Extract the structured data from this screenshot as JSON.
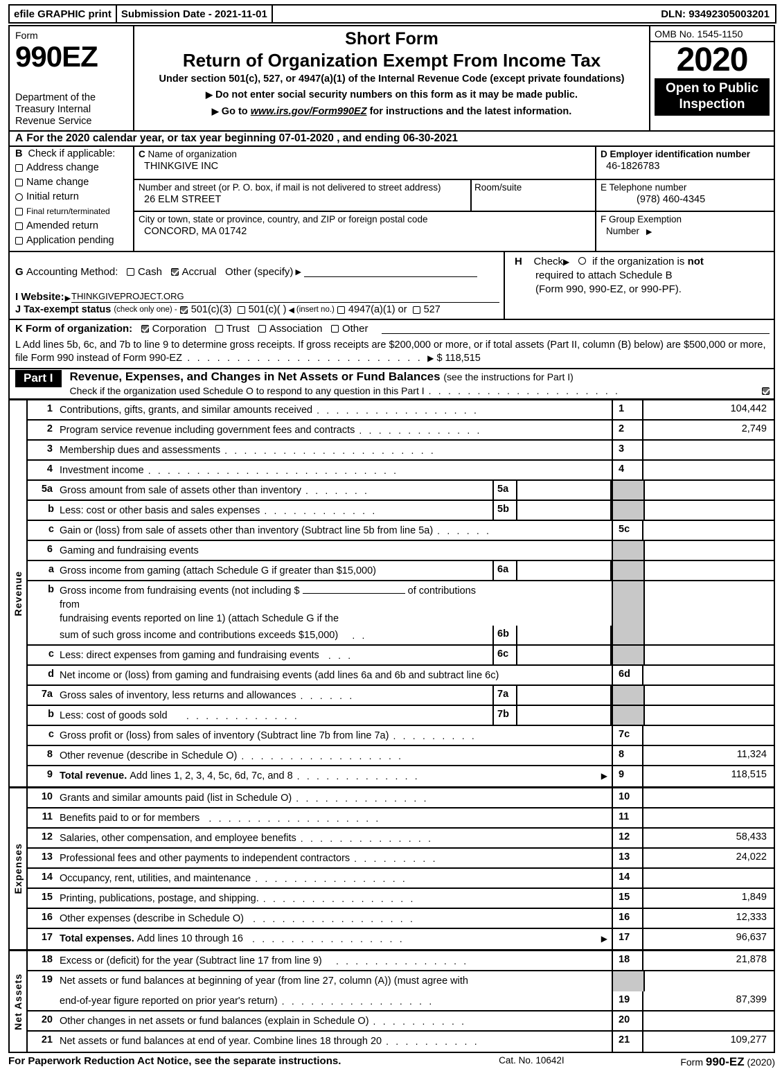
{
  "efile": {
    "print_label": "efile GRAPHIC print",
    "submission_date": "Submission Date - 2021-11-01",
    "dln": "DLN: 93492305003201"
  },
  "header": {
    "form_label": "Form",
    "form_number": "990EZ",
    "department": "Department of the Treasury Internal Revenue Service",
    "title_short": "Short Form",
    "title_main": "Return of Organization Exempt From Income Tax",
    "subtitle": "Under section 501(c), 527, or 4947(a)(1) of the Internal Revenue Code (except private foundations)",
    "bullet1": "Do not enter social security numbers on this form as it may be made public.",
    "bullet2_pre": "Go to",
    "bullet2_link": "www.irs.gov/Form990EZ",
    "bullet2_post": "for instructions and the latest information.",
    "omb": "OMB No. 1545-1150",
    "tax_year": "2020",
    "open_to_public": "Open to Public Inspection"
  },
  "line_a": {
    "letter": "A",
    "text": "For the 2020 calendar year, or tax year beginning 07-01-2020 , and ending 06-30-2021"
  },
  "section_b": {
    "letter": "B",
    "heading": "Check if applicable:",
    "items": [
      {
        "label": "Address change",
        "checked": false,
        "shape": "square"
      },
      {
        "label": "Name change",
        "checked": false,
        "shape": "square"
      },
      {
        "label": "Initial return",
        "checked": false,
        "shape": "round"
      },
      {
        "label": "Final return/terminated",
        "checked": false,
        "shape": "square",
        "small": true
      },
      {
        "label": "Amended return",
        "checked": false,
        "shape": "square"
      },
      {
        "label": "Application pending",
        "checked": false,
        "shape": "square"
      }
    ]
  },
  "section_c": {
    "letter": "C",
    "name_label": "Name of organization",
    "name_value": "THINKGIVE INC",
    "street_label": "Number and street (or P. O. box, if mail is not delivered to street address)",
    "street_value": "26 ELM STREET",
    "room_label": "Room/suite",
    "room_value": "",
    "city_label": "City or town, state or province, country, and ZIP or foreign postal code",
    "city_value": "CONCORD, MA   01742"
  },
  "section_d": {
    "ein_label": "D Employer identification number",
    "ein_value": "46-1826783",
    "tel_label": "E Telephone number",
    "tel_value": "(978) 460-4345",
    "group_label": "F Group Exemption",
    "group_label2": "Number",
    "group_value": ""
  },
  "section_g": {
    "letter": "G",
    "label": "Accounting Method:",
    "cash": "Cash",
    "cash_checked": false,
    "accrual": "Accrual",
    "accrual_checked": true,
    "other": "Other (specify)",
    "other_value": ""
  },
  "section_h": {
    "letter": "H",
    "text_pre": "Check",
    "text_post": "if the organization is",
    "not_word": "not",
    "line2": "required to attach Schedule B",
    "line3": "(Form 990, 990-EZ, or 990-PF).",
    "checked": false
  },
  "section_i": {
    "label": "I Website:",
    "value": "THINKGIVEPROJECT.ORG"
  },
  "section_j": {
    "label": "J Tax-exempt status",
    "note": "(check only one) -",
    "opt1": "501(c)(3)",
    "opt1_checked": true,
    "opt2": "501(c)(    )",
    "opt2_checked": false,
    "insert": "(insert no.)",
    "opt3": "4947(a)(1) or",
    "opt3_checked": false,
    "opt4": "527",
    "opt4_checked": false
  },
  "section_k": {
    "label": "K Form of organization:",
    "options": [
      {
        "label": "Corporation",
        "checked": true
      },
      {
        "label": "Trust",
        "checked": false
      },
      {
        "label": "Association",
        "checked": false
      },
      {
        "label": "Other",
        "checked": false
      }
    ]
  },
  "section_l": {
    "text": "L Add lines 5b, 6c, and 7b to line 9 to determine gross receipts. If gross receipts are $200,000 or more, or if total assets (Part II, column (B) below) are $500,000 or more, file Form 990 instead of Form 990-EZ",
    "amount": "$ 118,515"
  },
  "part1": {
    "tag": "Part I",
    "title": "Revenue, Expenses, and Changes in Net Assets or Fund Balances",
    "title_note": "(see the instructions for Part I)",
    "check_text": "Check if the organization used Schedule O to respond to any question in this Part I",
    "checked": true
  },
  "side_labels": {
    "revenue": "Revenue",
    "expenses": "Expenses",
    "net_assets": "Net Assets"
  },
  "revenue_lines": [
    {
      "no": "1",
      "text": "Contributions, gifts, grants, and similar amounts received",
      "box": "1",
      "amount": "104,442",
      "dots": true
    },
    {
      "no": "2",
      "text": "Program service revenue including government fees and contracts",
      "box": "2",
      "amount": "2,749",
      "dots": true
    },
    {
      "no": "3",
      "text": "Membership dues and assessments",
      "box": "3",
      "amount": "",
      "dots": true
    },
    {
      "no": "4",
      "text": "Investment income",
      "box": "4",
      "amount": "",
      "dots": true
    },
    {
      "no": "5a",
      "text": "Gross amount from sale of assets other than inventory",
      "sub_box": "5a",
      "sub_amount": "",
      "box": "",
      "amount": "",
      "dots": true,
      "gap": true
    },
    {
      "no": "b",
      "text": "Less: cost or other basis and sales expenses",
      "sub_box": "5b",
      "sub_amount": "",
      "box": "",
      "amount": "",
      "dots": true,
      "gap": true
    },
    {
      "no": "c",
      "text": "Gain or (loss) from sale of assets other than inventory (Subtract line 5b from line 5a)",
      "box": "5c",
      "amount": "",
      "dots": true
    },
    {
      "no": "6",
      "text": "Gaming and fundraising events",
      "box": "",
      "amount": "",
      "dots": false,
      "gap": true
    },
    {
      "no": "a",
      "text": "Gross income from gaming (attach Schedule G if greater than $15,000)",
      "sub_box": "6a",
      "sub_amount": "",
      "box": "",
      "amount": "",
      "dots": false,
      "gap": true
    },
    {
      "no": "b",
      "text": "Gross income from fundraising events (not including $ ____________ of contributions from fundraising events reported on line 1) (attach Schedule G if the",
      "box": "",
      "amount": "",
      "dots": false,
      "gap": true,
      "tall": true
    },
    {
      "no": "",
      "text": "sum of such gross income and contributions exceeds $15,000)",
      "sub_box": "6b",
      "sub_amount": "",
      "box": "",
      "amount": "",
      "dots": true,
      "gap": true
    },
    {
      "no": "c",
      "text": "Less: direct expenses from gaming and fundraising events",
      "sub_box": "6c",
      "sub_amount": "",
      "box": "",
      "amount": "",
      "dots": true,
      "gap": true
    },
    {
      "no": "d",
      "text": "Net income or (loss) from gaming and fundraising events (add lines 6a and 6b and subtract line 6c)",
      "box": "6d",
      "amount": "",
      "dots": false
    },
    {
      "no": "7a",
      "text": "Gross sales of inventory, less returns and allowances",
      "sub_box": "7a",
      "sub_amount": "",
      "box": "",
      "amount": "",
      "dots": true,
      "gap": true
    },
    {
      "no": "b",
      "text": "Less: cost of goods sold",
      "sub_box": "7b",
      "sub_amount": "",
      "box": "",
      "amount": "",
      "dots": true,
      "gap": true
    },
    {
      "no": "c",
      "text": "Gross profit or (loss) from sales of inventory (Subtract line 7b from line 7a)",
      "box": "7c",
      "amount": "",
      "dots": true
    },
    {
      "no": "8",
      "text": "Other revenue (describe in Schedule O)",
      "box": "8",
      "amount": "11,324",
      "dots": true
    },
    {
      "no": "9",
      "text": "Total revenue. Add lines 1, 2, 3, 4, 5c, 6d, 7c, and 8",
      "bold_prefix": "Total revenue.",
      "box": "9",
      "amount": "118,515",
      "dots": true,
      "arrow": true
    }
  ],
  "expense_lines": [
    {
      "no": "10",
      "text": "Grants and similar amounts paid (list in Schedule O)",
      "box": "10",
      "amount": "",
      "dots": true
    },
    {
      "no": "11",
      "text": "Benefits paid to or for members",
      "box": "11",
      "amount": "",
      "dots": true
    },
    {
      "no": "12",
      "text": "Salaries, other compensation, and employee benefits",
      "box": "12",
      "amount": "58,433",
      "dots": true
    },
    {
      "no": "13",
      "text": "Professional fees and other payments to independent contractors",
      "box": "13",
      "amount": "24,022",
      "dots": true
    },
    {
      "no": "14",
      "text": "Occupancy, rent, utilities, and maintenance",
      "box": "14",
      "amount": "",
      "dots": true
    },
    {
      "no": "15",
      "text": "Printing, publications, postage, and shipping.",
      "box": "15",
      "amount": "1,849",
      "dots": true
    },
    {
      "no": "16",
      "text": "Other expenses (describe in Schedule O)",
      "box": "16",
      "amount": "12,333",
      "dots": true
    },
    {
      "no": "17",
      "text": "Total expenses. Add lines 10 through 16",
      "bold_prefix": "Total expenses.",
      "box": "17",
      "amount": "96,637",
      "dots": true,
      "arrow": true
    }
  ],
  "netasset_lines": [
    {
      "no": "18",
      "text": "Excess or (deficit) for the year (Subtract line 17 from line 9)",
      "box": "18",
      "amount": "21,878",
      "dots": true
    },
    {
      "no": "19",
      "text": "Net assets or fund balances at beginning of year (from line 27, column (A)) (must agree with",
      "box": "",
      "amount": "",
      "dots": false,
      "gap": true
    },
    {
      "no": "",
      "text": "end-of-year figure reported on prior year's return)",
      "box": "19",
      "amount": "87,399",
      "dots": true
    },
    {
      "no": "20",
      "text": "Other changes in net assets or fund balances (explain in Schedule O)",
      "box": "20",
      "amount": "",
      "dots": true
    },
    {
      "no": "21",
      "text": "Net assets or fund balances at end of year. Combine lines 18 through 20",
      "box": "21",
      "amount": "109,277",
      "dots": true
    }
  ],
  "footer": {
    "notice": "For Paperwork Reduction Act Notice, see the separate instructions.",
    "cat": "Cat. No. 10642I",
    "form_pre": "Form",
    "form_no": "990-EZ",
    "form_year": "(2020)"
  }
}
